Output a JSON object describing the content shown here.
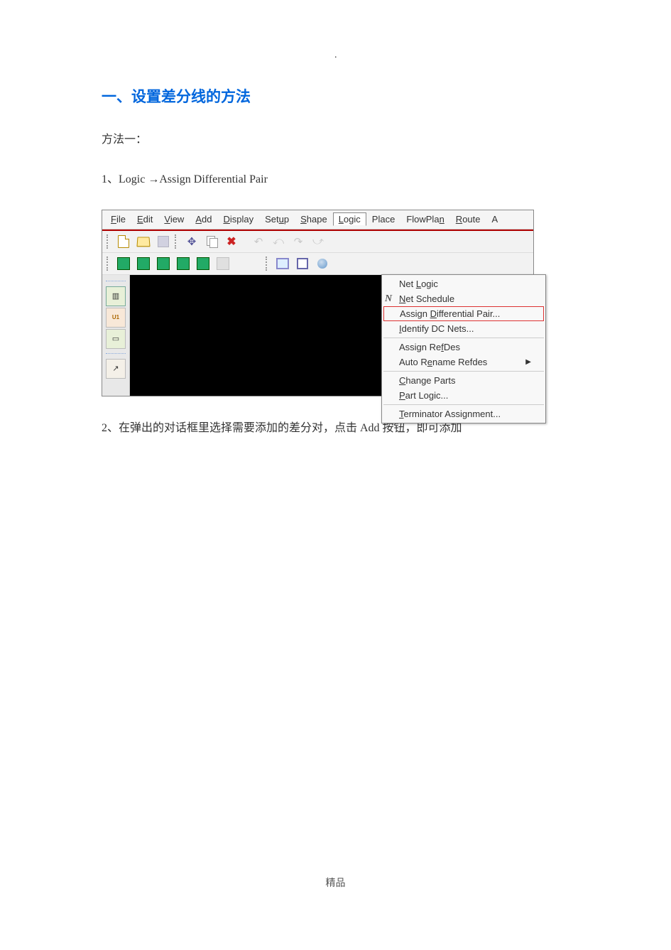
{
  "page_mark": ".",
  "title": "一、设置差分线的方法",
  "para_method": "方法一：",
  "para_step1_prefix": "1、",
  "para_step1_text": "Logic →Assign  Differential  Pair",
  "para_step2": "2、在弹出的对话框里选择需要添加的差分对，点击 Add 按钮，即可添加",
  "footer": "精品",
  "menubar": [
    {
      "u": "F",
      "rest": "ile"
    },
    {
      "u": "E",
      "rest": "dit"
    },
    {
      "u": "V",
      "rest": "iew"
    },
    {
      "u": "A",
      "rest": "dd"
    },
    {
      "u": "D",
      "rest": "isplay"
    },
    {
      "u": "",
      "rest": "Setup",
      "pre": "Set",
      "u2": "u",
      "post": "p"
    },
    {
      "u": "S",
      "rest": "hape"
    },
    {
      "u": "L",
      "rest": "ogic",
      "open": true
    },
    {
      "u": "",
      "rest": "Place"
    },
    {
      "u": "",
      "rest": "FlowPla",
      "u2": "n",
      "post": ""
    },
    {
      "u": "R",
      "rest": "oute"
    },
    {
      "u": "",
      "rest": "A"
    }
  ],
  "simple_menubar": {
    "file": "File",
    "edit": "Edit",
    "view": "View",
    "add": "Add",
    "display": "Display",
    "setup": "Setup",
    "shape": "Shape",
    "logic": "Logic",
    "place": "Place",
    "flowplan": "FlowPlan",
    "route": "Route",
    "trailing": "A"
  },
  "dropdown": {
    "net_logic": "Net Logic",
    "net_schedule": "Net Schedule",
    "assign_diff": "Assign Differential Pair...",
    "identify_dc": "Identify DC Nets...",
    "assign_refdes": "Assign RefDes",
    "auto_rename": "Auto Rename Refdes",
    "change_parts": "Change Parts",
    "part_logic": "Part Logic...",
    "terminator": "Terminator Assignment..."
  },
  "underlines": {
    "file": "F",
    "edit": "E",
    "view": "V",
    "add": "A",
    "display": "D",
    "setup": "u",
    "shape": "S",
    "logic": "L",
    "flowplan": "n",
    "route": "R",
    "net_logic": "L",
    "net_schedule": "N",
    "assign_diff": "D",
    "identify_dc": "I",
    "assign_refdes": "f",
    "auto_rename": "e",
    "change_parts": "C",
    "part_logic": "P",
    "terminator": "T"
  },
  "icon_n": "N",
  "lt_u1": "U1"
}
